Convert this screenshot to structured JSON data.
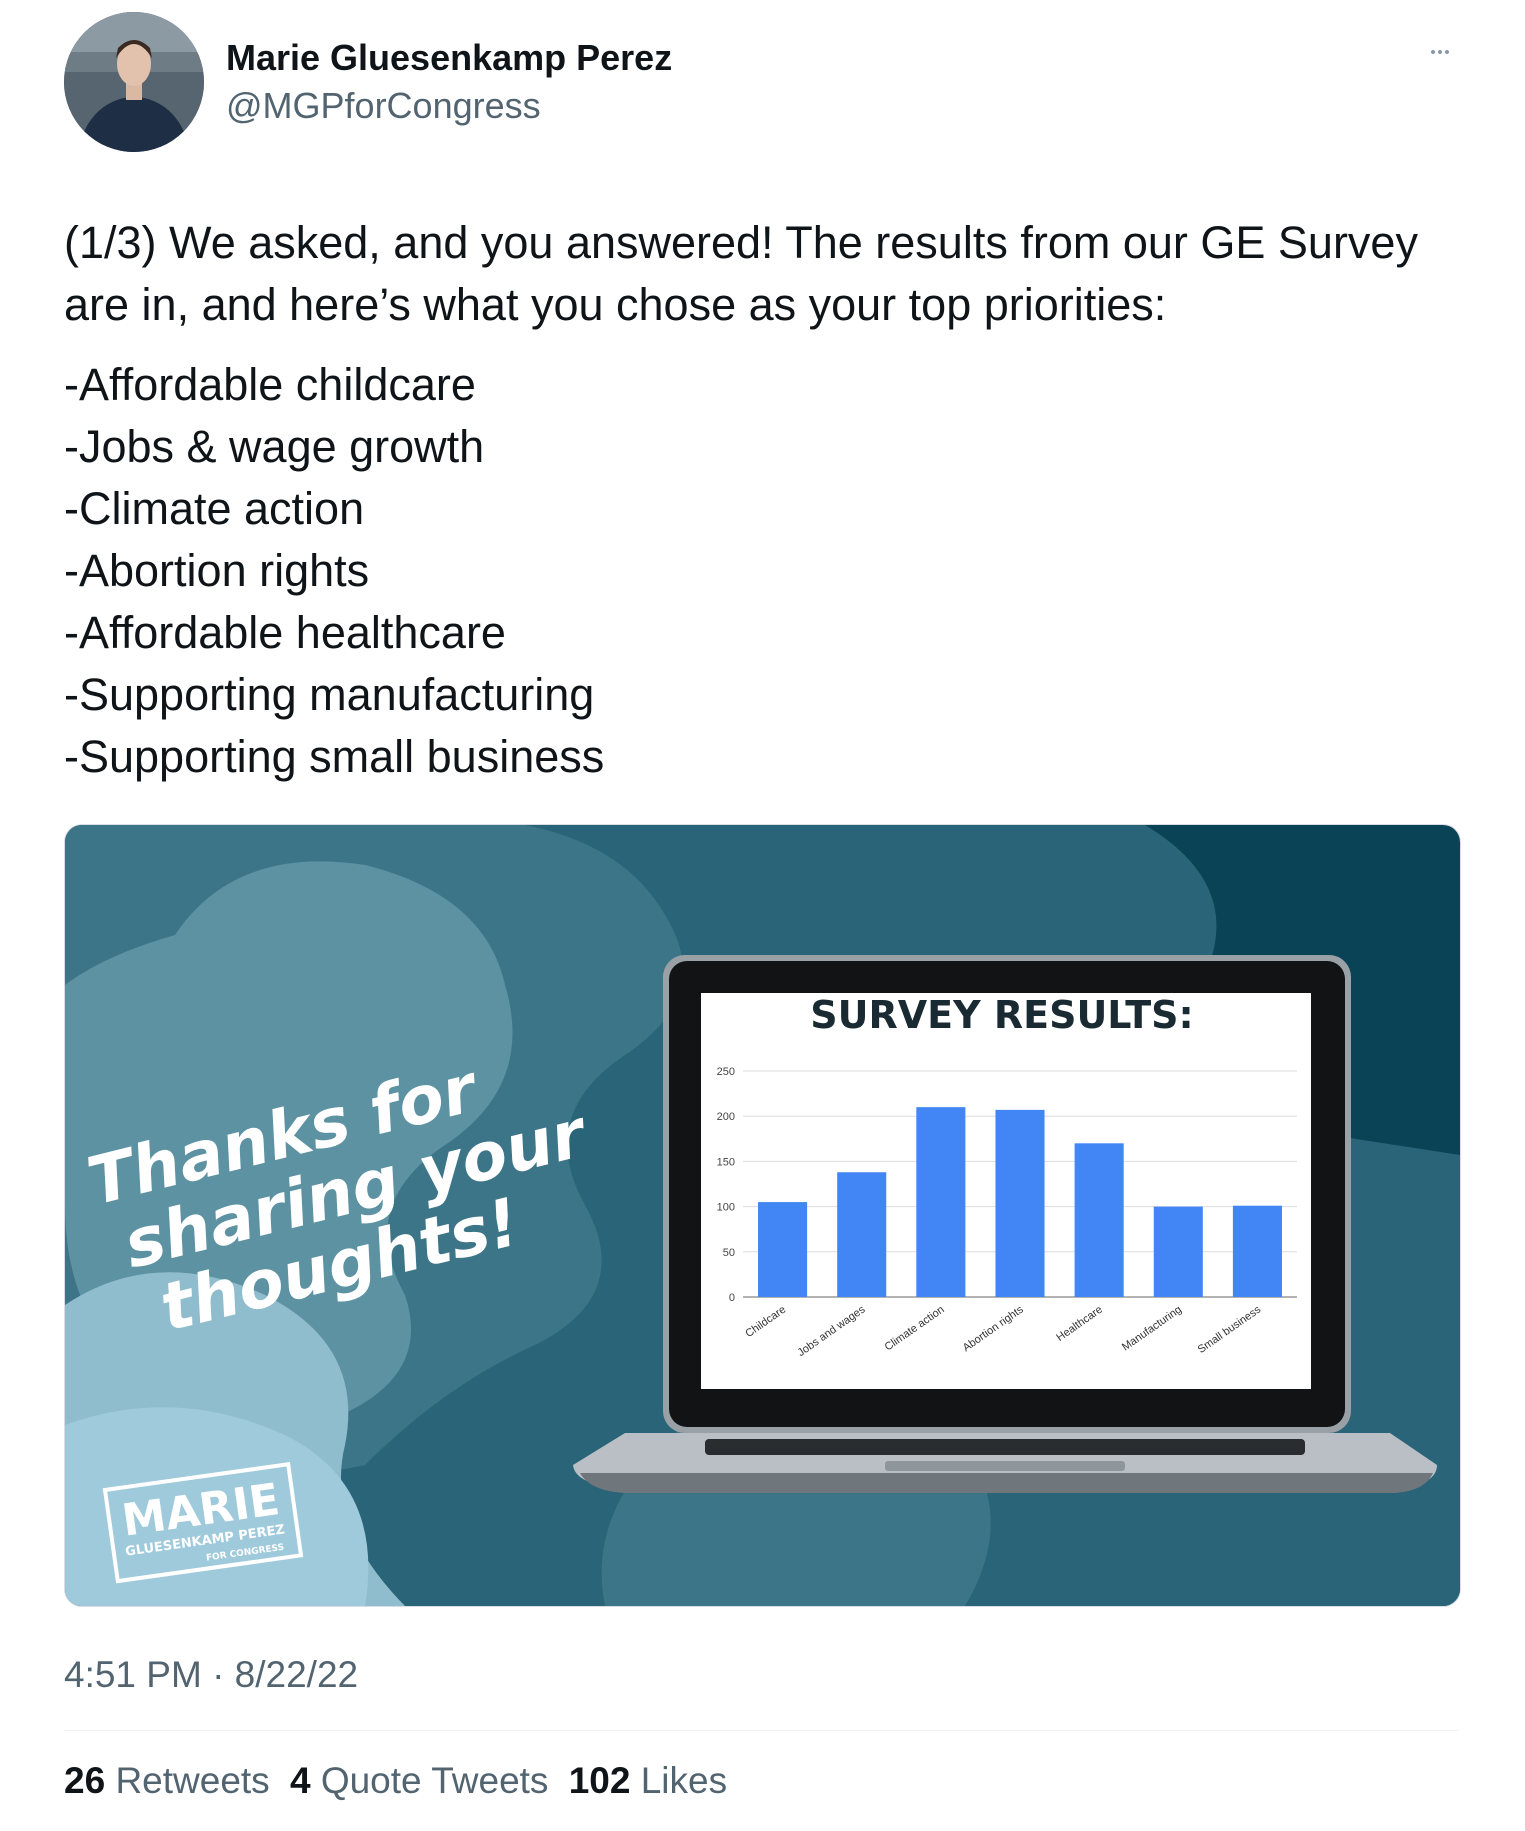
{
  "author": {
    "name": "Marie Gluesenkamp Perez",
    "handle": "@MGPforCongress"
  },
  "tweet": {
    "intro": "(1/3) We asked, and you answered! The results from our GE Survey are in, and here’s what you chose as your top priorities:",
    "priorities": [
      "-Affordable childcare",
      "-Jobs & wage growth",
      "-Climate action",
      "-Abortion rights",
      "-Affordable healthcare",
      "-Supporting manufacturing",
      "-Supporting small business"
    ],
    "timestamp": "4:51 PM · 8/22/22"
  },
  "media": {
    "thanks_lines": [
      "Thanks for",
      "sharing your",
      "thoughts!"
    ],
    "logo_name": "MARIE",
    "logo_sub": "GLUESENKAMP PEREZ",
    "logo_tag": "FOR CONGRESS",
    "colors": {
      "bg_dark": "#0b4356",
      "bg_mid": "#2a6478",
      "bg_light": "#8fbdcd",
      "bar": "#4285f4"
    }
  },
  "chart_data": {
    "type": "bar",
    "title": "SURVEY RESULTS:",
    "categories": [
      "Childcare",
      "Jobs and wages",
      "Climate action",
      "Abortion rights",
      "Healthcare",
      "Manufacturing",
      "Small business"
    ],
    "values": [
      105,
      138,
      210,
      207,
      170,
      100,
      101
    ],
    "yticks": [
      "0",
      "50",
      "100",
      "150",
      "200",
      "250"
    ],
    "ylim": [
      0,
      250
    ],
    "grid": true
  },
  "stats": [
    {
      "count": "26",
      "label": "Retweets"
    },
    {
      "count": "4",
      "label": "Quote Tweets"
    },
    {
      "count": "102",
      "label": "Likes"
    }
  ],
  "icons": {
    "more": "more-dots-icon"
  }
}
